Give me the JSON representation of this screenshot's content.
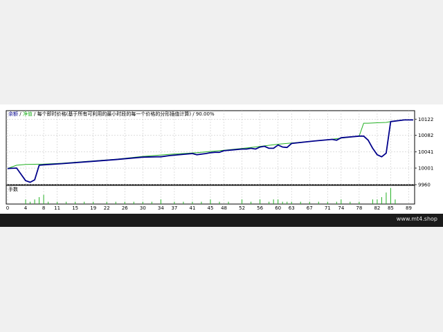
{
  "legend": {
    "balance_label": "余额",
    "separator1": " / ",
    "equity_label": "净值",
    "separator2": " / ",
    "model_text": "每个即时价格(基于所有可利用的最小时段的每一个价格的分形插值计算)",
    "separator3": " / ",
    "quality": "90.00%"
  },
  "volume_label": "手数",
  "footer": {
    "site": "www.mt4.shop"
  },
  "colors": {
    "balance": "#00008b",
    "equity": "#22b022",
    "volume": "#22b022",
    "grid": "#c8c8c8",
    "footer_bg": "#1b1b1b"
  },
  "chart_data": {
    "type": "line",
    "y_ticks": [
      9960,
      10001,
      10041,
      10082,
      10122
    ],
    "ylim": [
      9960,
      10143
    ],
    "x_ticks": [
      0,
      4,
      8,
      11,
      15,
      19,
      22,
      26,
      30,
      34,
      37,
      41,
      45,
      48,
      52,
      56,
      60,
      63,
      67,
      71,
      74,
      78,
      82,
      85,
      89
    ],
    "xlim": [
      0,
      90
    ],
    "series": [
      {
        "name": "余额",
        "x": [
          0,
          2,
          4,
          5,
          6,
          7,
          8,
          12,
          18,
          24,
          30,
          33,
          34,
          36,
          41,
          42,
          44,
          45,
          46,
          47,
          48,
          50,
          52,
          53,
          54,
          55,
          56,
          57,
          58,
          59,
          60,
          61,
          62,
          63,
          68,
          72,
          73,
          74,
          78,
          79,
          80,
          81,
          82,
          83,
          84,
          85,
          88,
          90
        ],
        "y": [
          10000,
          10001,
          9970,
          9966,
          9972,
          10008,
          10009,
          10012,
          10017,
          10022,
          10028,
          10029,
          10029,
          10032,
          10037,
          10034,
          10037,
          10039,
          10040,
          10040,
          10044,
          10046,
          10048,
          10048,
          10050,
          10048,
          10053,
          10055,
          10050,
          10050,
          10058,
          10053,
          10052,
          10062,
          10068,
          10072,
          10070,
          10076,
          10080,
          10080,
          10070,
          10050,
          10034,
          10029,
          10038,
          10116,
          10120,
          10120
        ]
      },
      {
        "name": "净值",
        "x": [
          0,
          2,
          4,
          8,
          12,
          18,
          24,
          30,
          36,
          42,
          48,
          54,
          60,
          63,
          70,
          74,
          78,
          79,
          80,
          82,
          84,
          85,
          86,
          88,
          90
        ],
        "y": [
          10000,
          10008,
          10010,
          10011,
          10013,
          10018,
          10023,
          10030,
          10035,
          10039,
          10045,
          10052,
          10060,
          10063,
          10070,
          10075,
          10080,
          10112,
          10112,
          10113,
          10114,
          10116,
          10118,
          10120,
          10120
        ]
      }
    ],
    "volume": {
      "name": "手数",
      "x": [
        4,
        5,
        6,
        7,
        8,
        9,
        11,
        13,
        15,
        17,
        19,
        22,
        24,
        26,
        28,
        30,
        32,
        34,
        37,
        39,
        41,
        43,
        45,
        47,
        49,
        52,
        54,
        56,
        58,
        59,
        60,
        61,
        62,
        63,
        65,
        67,
        69,
        71,
        73,
        74,
        76,
        78,
        81,
        82,
        83,
        84,
        85,
        86
      ],
      "y": [
        2,
        1,
        2,
        3,
        4,
        1,
        1,
        1,
        1,
        1,
        1,
        1,
        1,
        1,
        1,
        1,
        1,
        2,
        1,
        1,
        1,
        1,
        2,
        1,
        1,
        2,
        1,
        2,
        1,
        2,
        2,
        1,
        1,
        1,
        1,
        1,
        1,
        1,
        1,
        2,
        1,
        1,
        2,
        2,
        3,
        5,
        7,
        2
      ],
      "ylim": [
        0,
        7.5
      ]
    }
  }
}
